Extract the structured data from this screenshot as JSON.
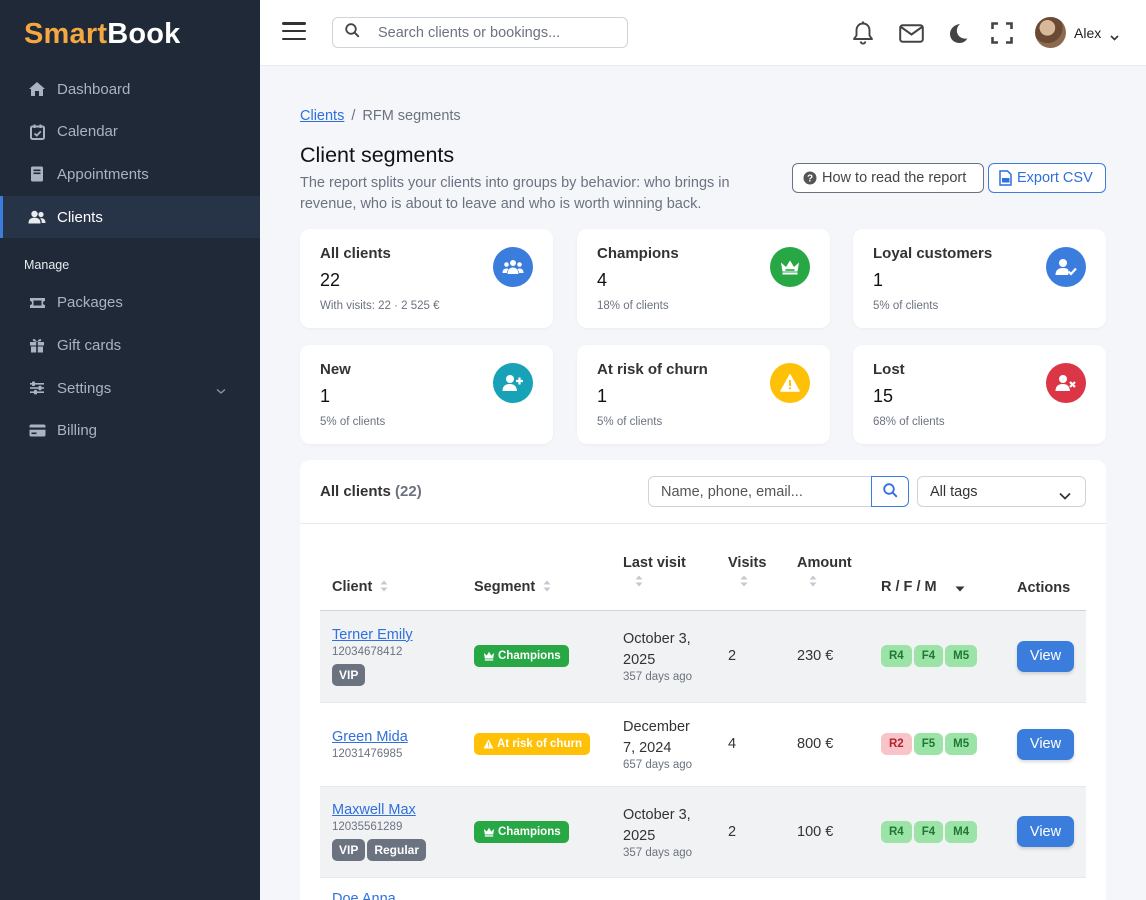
{
  "brand": {
    "part1": "Smart",
    "part2": "Book"
  },
  "sidebar": {
    "items": [
      {
        "label": "Dashboard",
        "icon": "home-icon"
      },
      {
        "label": "Calendar",
        "icon": "calendar-icon"
      },
      {
        "label": "Appointments",
        "icon": "book-icon"
      },
      {
        "label": "Clients",
        "icon": "users-icon",
        "active": true
      }
    ],
    "section_label": "Manage",
    "manage_items": [
      {
        "label": "Packages",
        "icon": "ticket-icon"
      },
      {
        "label": "Gift cards",
        "icon": "gift-icon"
      },
      {
        "label": "Settings",
        "icon": "sliders-icon"
      },
      {
        "label": "Billing",
        "icon": "credit-card-icon"
      }
    ]
  },
  "topbar": {
    "search_placeholder": "Search clients or bookings...",
    "user_name": "Alex"
  },
  "breadcrumb": {
    "parent": "Clients",
    "current": "RFM segments"
  },
  "page": {
    "title": "Client segments",
    "description": "The report splits your clients into groups by behavior: who brings in revenue, who is about to leave and who is worth winning back.",
    "help_button": "How to read the report",
    "export_button": "Export CSV"
  },
  "cards": [
    {
      "title": "All clients",
      "value": "22",
      "sub": "With visits: 22 · 2 525 €",
      "color": "#3b7ddd",
      "icon": "users-icon"
    },
    {
      "title": "Champions",
      "value": "4",
      "sub": "18% of clients",
      "color": "#28a745",
      "icon": "crown-icon"
    },
    {
      "title": "Loyal customers",
      "value": "1",
      "sub": "5% of clients",
      "color": "#3b7ddd",
      "icon": "user-check-icon"
    },
    {
      "title": "New",
      "value": "1",
      "sub": "5% of clients",
      "color": "#17a2b8",
      "icon": "user-plus-icon"
    },
    {
      "title": "At risk of churn",
      "value": "1",
      "sub": "5% of clients",
      "color": "#ffc107",
      "icon": "warning-icon"
    },
    {
      "title": "Lost",
      "value": "15",
      "sub": "68% of clients",
      "color": "#dc3545",
      "icon": "user-x-icon"
    }
  ],
  "table": {
    "title": "All clients",
    "count": "(22)",
    "filter_placeholder": "Name, phone, email...",
    "tags_select": "All tags",
    "headers": {
      "client": "Client",
      "segment": "Segment",
      "last_visit": "Last visit",
      "visits": "Visits",
      "amount": "Amount",
      "rfm": "R / F / M",
      "actions": "Actions"
    },
    "view_label": "View",
    "rows": [
      {
        "name": "Terner Emily",
        "phone": "12034678412",
        "tags": [
          "VIP"
        ],
        "segment": "Champions",
        "segment_type": "champ",
        "date_line1": "October 3,",
        "date_line2": "2025",
        "ago": "357 days ago",
        "visits": "2",
        "amount": "230 €",
        "rfm": [
          {
            "label": "R4",
            "tone": "g"
          },
          {
            "label": "F4",
            "tone": "g"
          },
          {
            "label": "M5",
            "tone": "g"
          }
        ]
      },
      {
        "name": "Green Mida",
        "phone": "12031476985",
        "tags": [],
        "segment": "At risk of churn",
        "segment_type": "risk",
        "date_line1": "December",
        "date_line2": "7, 2024",
        "ago": "657 days ago",
        "visits": "4",
        "amount": "800 €",
        "rfm": [
          {
            "label": "R2",
            "tone": "r"
          },
          {
            "label": "F5",
            "tone": "g"
          },
          {
            "label": "M5",
            "tone": "g"
          }
        ]
      },
      {
        "name": "Maxwell Max",
        "phone": "12035561289",
        "tags": [
          "VIP",
          "Regular"
        ],
        "segment": "Champions",
        "segment_type": "champ",
        "date_line1": "October 3,",
        "date_line2": "2025",
        "ago": "357 days ago",
        "visits": "2",
        "amount": "100 €",
        "rfm": [
          {
            "label": "R4",
            "tone": "g"
          },
          {
            "label": "F4",
            "tone": "g"
          },
          {
            "label": "M4",
            "tone": "g"
          }
        ]
      },
      {
        "name": "Doe Anna"
      }
    ]
  }
}
